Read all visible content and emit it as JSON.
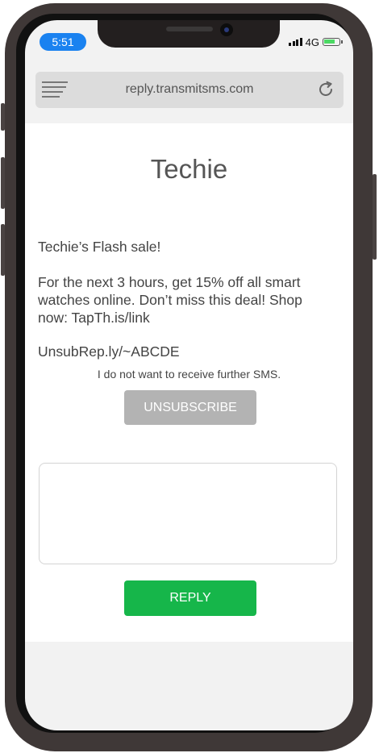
{
  "status_bar": {
    "time": "5:51",
    "network": "4G"
  },
  "browser": {
    "url": "reply.transmitsms.com"
  },
  "message": {
    "brand": "Techie",
    "headline": "Techie’s Flash sale!",
    "body": "For the next 3 hours, get 15% off all smart watches online. Don’t miss this deal! Shop now: TapTh.is/link",
    "unsub_link": "UnsubRep.ly/~ABCDE"
  },
  "unsubscribe": {
    "notice": "I do not want to receive further SMS.",
    "button_label": "UNSUBSCRIBE"
  },
  "reply": {
    "input_value": "",
    "button_label": "REPLY"
  },
  "colors": {
    "time_pill": "#1a82f0",
    "reply_button": "#16b64a",
    "unsubscribe_button": "#b3b3b3",
    "phone_frame": "#3f3837"
  },
  "icons": {
    "menu": "hamburger-icon",
    "reload": "reload-icon",
    "signal": "signal-icon",
    "battery": "battery-icon"
  }
}
